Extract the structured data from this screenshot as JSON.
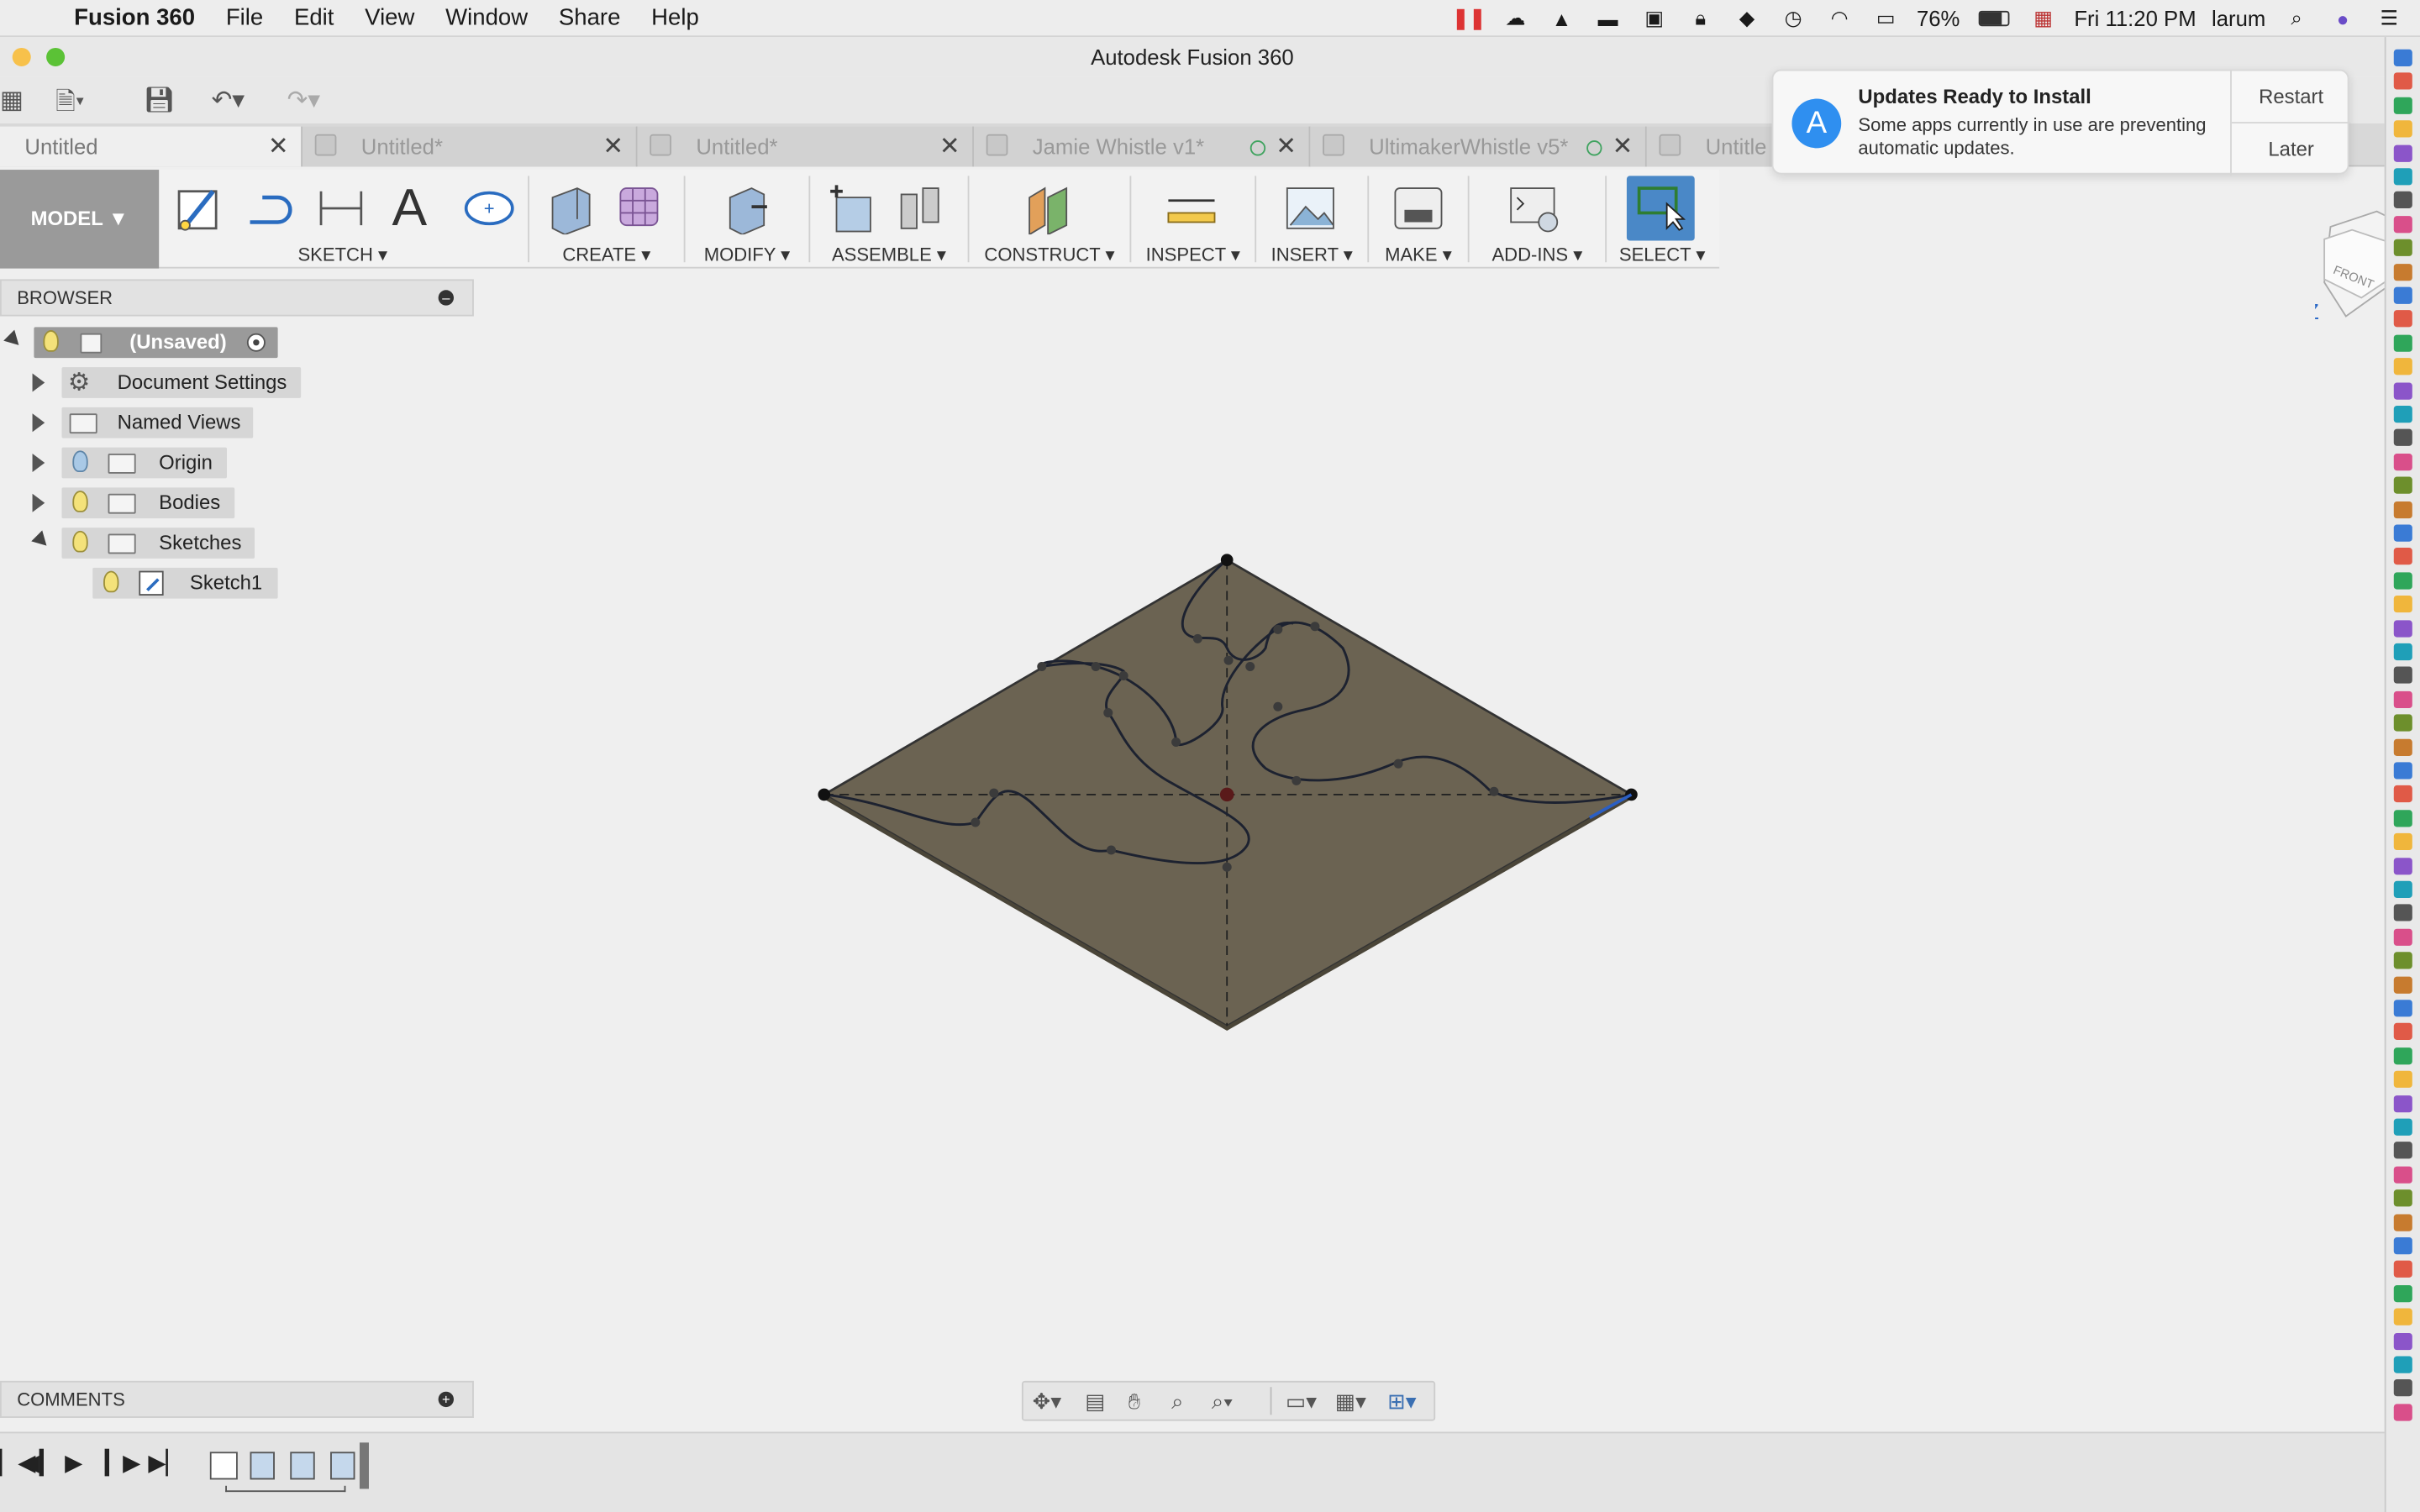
{
  "menubar": {
    "app_name": "Fusion 360",
    "items": [
      "File",
      "Edit",
      "View",
      "Window",
      "Share",
      "Help"
    ],
    "battery": "76%",
    "clock": "Fri 11:20 PM",
    "user": "larum"
  },
  "window": {
    "title": "Autodesk Fusion 360"
  },
  "tabs": [
    {
      "label": "Untitled"
    },
    {
      "label": "Untitled*"
    },
    {
      "label": "Untitled*"
    },
    {
      "label": "Jamie Whistle v1*"
    },
    {
      "label": "UltimakerWhistle v5*"
    },
    {
      "label": "Untitle"
    }
  ],
  "ribbon": {
    "workspace": "MODEL ▼",
    "groups": {
      "sketch": "SKETCH ▾",
      "create": "CREATE ▾",
      "modify": "MODIFY ▾",
      "assemble": "ASSEMBLE ▾",
      "construct": "CONSTRUCT ▾",
      "inspect": "INSPECT ▾",
      "insert": "INSERT ▾",
      "make": "MAKE ▾",
      "addins": "ADD-INS ▾",
      "select": "SELECT ▾"
    },
    "sketch_text_glyph": "A"
  },
  "browser": {
    "title": "BROWSER",
    "root": "(Unsaved)",
    "items": {
      "document_settings": "Document Settings",
      "named_views": "Named Views",
      "origin": "Origin",
      "bodies": "Bodies",
      "sketches": "Sketches",
      "sketch1": "Sketch1"
    }
  },
  "comments": {
    "title": "COMMENTS"
  },
  "notification": {
    "title": "Updates Ready to Install",
    "body": "Some apps currently in use are preventing automatic updates.",
    "restart": "Restart",
    "later": "Later"
  },
  "viewcube": {
    "face": "FRONT",
    "axis": "Z"
  },
  "colors": {
    "plate_fill": "#6b6352",
    "select_active": "#4a88c7",
    "model_button": "#9a9a9a"
  }
}
